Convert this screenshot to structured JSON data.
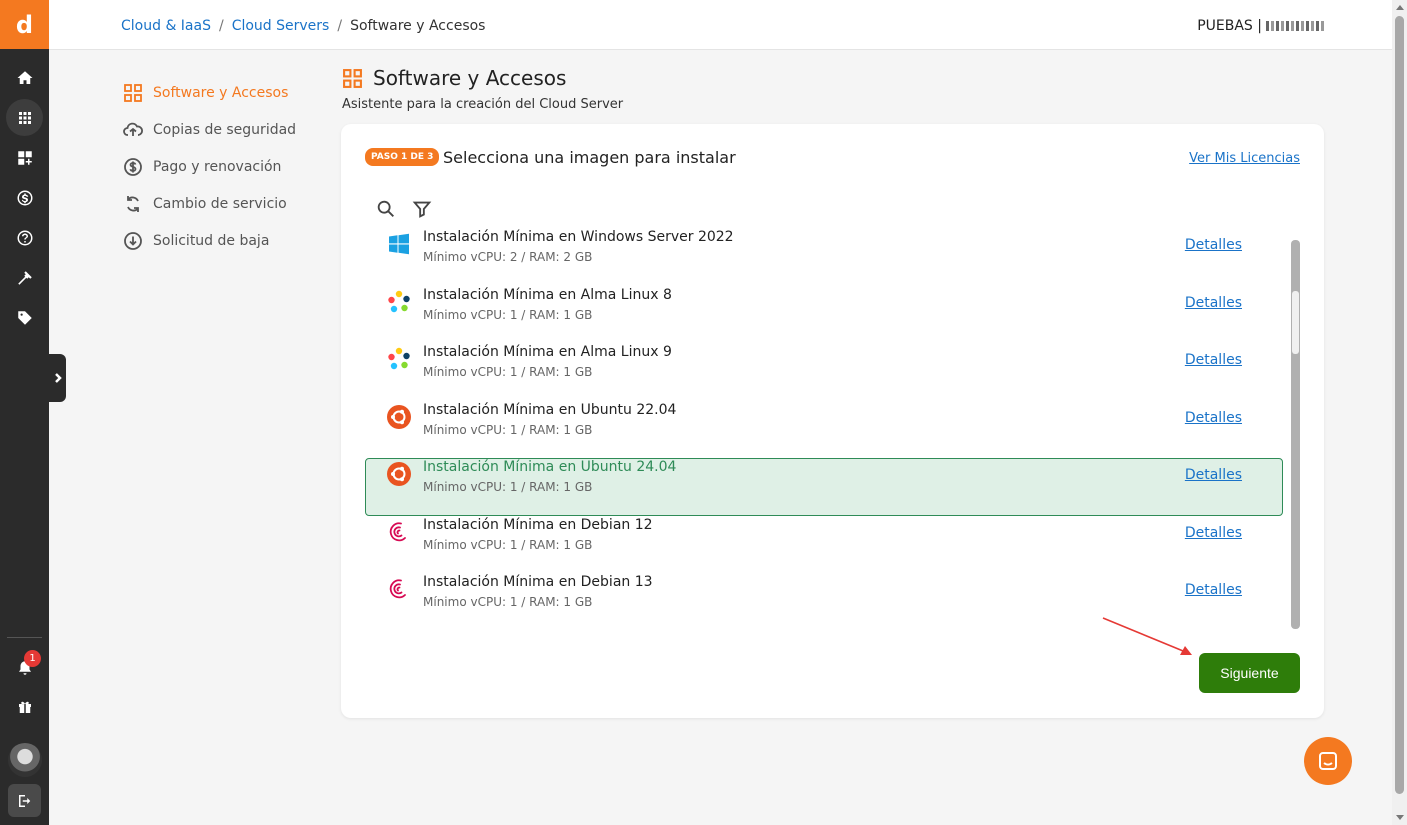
{
  "app": {
    "logo_letter": "d",
    "accent": "#f47920",
    "notification_count": "1"
  },
  "breadcrumb": {
    "items": [
      "Cloud & IaaS",
      "Cloud Servers"
    ],
    "current": "Software y Accesos",
    "separator": "/"
  },
  "account": {
    "label": "PUEBAS |"
  },
  "sidebar": {
    "items": [
      {
        "label": "Software y Accesos",
        "icon": "grid-icon",
        "active": true
      },
      {
        "label": "Copias de seguridad",
        "icon": "cloud-upload-icon",
        "active": false
      },
      {
        "label": "Pago y renovación",
        "icon": "dollar-icon",
        "active": false
      },
      {
        "label": "Cambio de servicio",
        "icon": "refresh-icon",
        "active": false
      },
      {
        "label": "Solicitud de baja",
        "icon": "download-circle-icon",
        "active": false
      }
    ]
  },
  "page": {
    "title": "Software y Accesos",
    "subtitle": "Asistente para la creación del Cloud Server"
  },
  "wizard": {
    "step_badge": "PASO 1 DE 3",
    "title": "Selecciona una imagen para instalar",
    "licenses_link": "Ver Mis Licencias",
    "next_button": "Siguiente"
  },
  "images": [
    {
      "name": "Instalación Mínima en Windows Server 2022",
      "spec": "Mínimo vCPU: 2 / RAM: 2 GB",
      "detail": "Detalles",
      "icon": "windows-icon",
      "selected": false
    },
    {
      "name": "Instalación Mínima en Alma Linux 8",
      "spec": "Mínimo vCPU: 1 / RAM: 1 GB",
      "detail": "Detalles",
      "icon": "almalinux-icon",
      "selected": false
    },
    {
      "name": "Instalación Mínima en Alma Linux 9",
      "spec": "Mínimo vCPU: 1 / RAM: 1 GB",
      "detail": "Detalles",
      "icon": "almalinux-icon",
      "selected": false
    },
    {
      "name": "Instalación Mínima en Ubuntu 22.04",
      "spec": "Mínimo vCPU: 1 / RAM: 1 GB",
      "detail": "Detalles",
      "icon": "ubuntu-icon",
      "selected": false
    },
    {
      "name": "Instalación Mínima en Ubuntu 24.04",
      "spec": "Mínimo vCPU: 1 / RAM: 1 GB",
      "detail": "Detalles",
      "icon": "ubuntu-icon",
      "selected": true
    },
    {
      "name": "Instalación Mínima en Debian 12",
      "spec": "Mínimo vCPU: 1 / RAM: 1 GB",
      "detail": "Detalles",
      "icon": "debian-icon",
      "selected": false
    },
    {
      "name": "Instalación Mínima en Debian 13",
      "spec": "Mínimo vCPU: 1 / RAM: 1 GB",
      "detail": "Detalles",
      "icon": "debian-icon",
      "selected": false
    }
  ],
  "colors": {
    "selected_bg": "#dff0e6",
    "selected_border": "#2e8b57",
    "next_button": "#2e7d0a",
    "link": "#1a73c8",
    "annotation_arrow": "#e53935"
  }
}
